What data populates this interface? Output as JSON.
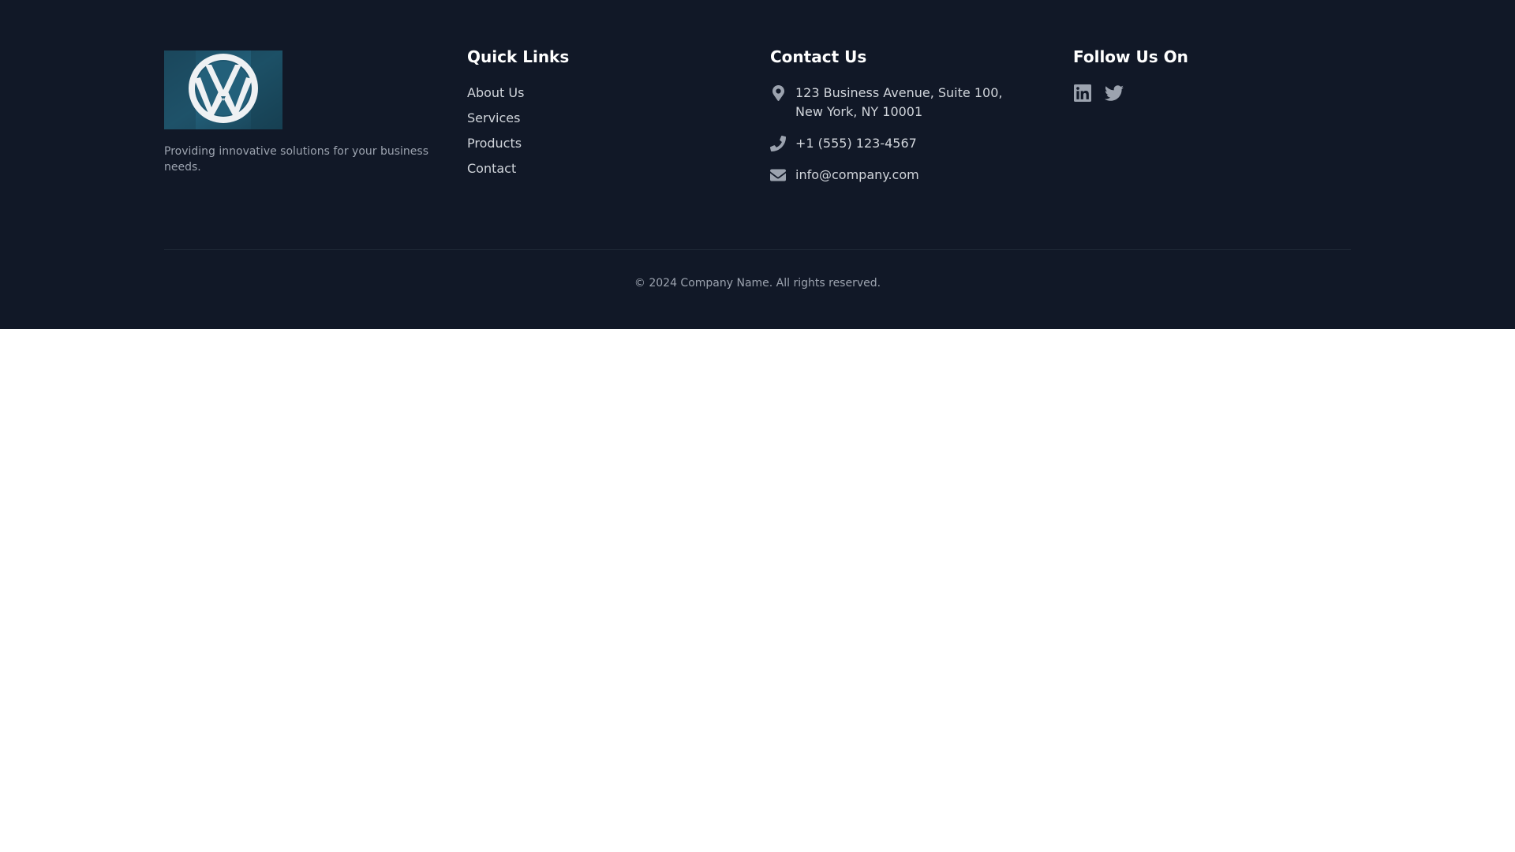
{
  "brand": {
    "logo_alt": "Company logo",
    "tagline": "Providing innovative solutions for your business needs."
  },
  "quick_links": {
    "heading": "Quick Links",
    "items": [
      {
        "label": "About Us"
      },
      {
        "label": "Services"
      },
      {
        "label": "Products"
      },
      {
        "label": "Contact"
      }
    ]
  },
  "contact": {
    "heading": "Contact Us",
    "address_line1": "123 Business Avenue, Suite 100,",
    "address_line2": "New York, NY 10001",
    "phone": "+1 (555) 123-4567",
    "email": "info@company.com",
    "icons": [
      "map-pin-icon",
      "phone-icon",
      "envelope-icon"
    ]
  },
  "social": {
    "heading": "Follow Us On",
    "icons": [
      "linkedin-icon",
      "twitter-icon"
    ]
  },
  "footer_bottom": {
    "copyright": "© 2024 Company Name. All rights reserved."
  },
  "colors": {
    "footer_bg": "#111827",
    "heading": "#ffffff",
    "text": "#d1d5db",
    "muted": "#9ca3af",
    "divider": "#1f2937",
    "logo_bg": "#1d4f66"
  }
}
